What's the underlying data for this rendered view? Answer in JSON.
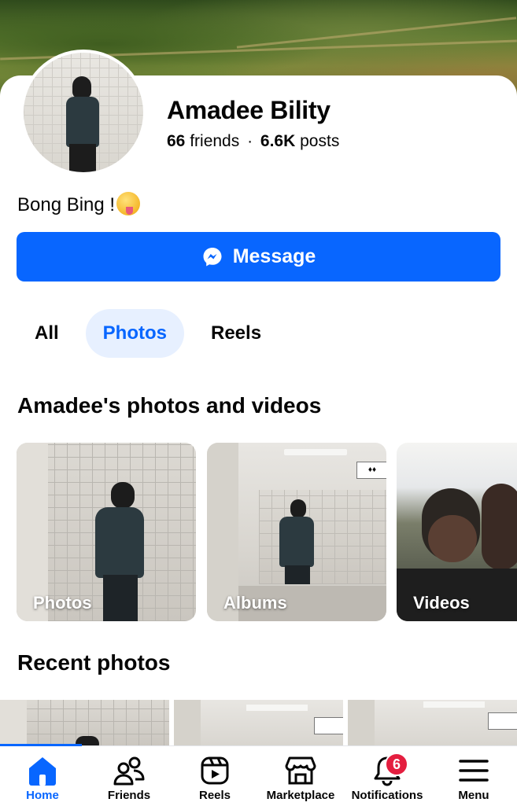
{
  "profile": {
    "name": "Amadee Bility",
    "friends_count": "66",
    "friends_label": "friends",
    "separator": "·",
    "posts_count": "6.6K",
    "posts_label": "posts",
    "bio": "Bong Bing !",
    "bio_emoji": "zany-face-emoji"
  },
  "actions": {
    "message_label": "Message",
    "message_icon": "messenger-icon",
    "accent": "#0866ff"
  },
  "tabs": [
    {
      "label": "All",
      "active": false
    },
    {
      "label": "Photos",
      "active": true
    },
    {
      "label": "Reels",
      "active": false
    }
  ],
  "media_section": {
    "title": "Amadee's photos and videos",
    "tiles": [
      {
        "label": "Photos"
      },
      {
        "label": "Albums"
      },
      {
        "label": "Videos"
      }
    ]
  },
  "recent_section": {
    "title": "Recent photos"
  },
  "bottom_nav": [
    {
      "label": "Home",
      "icon": "home-icon",
      "active": true
    },
    {
      "label": "Friends",
      "icon": "friends-icon",
      "active": false
    },
    {
      "label": "Reels",
      "icon": "reels-icon",
      "active": false
    },
    {
      "label": "Marketplace",
      "icon": "marketplace-icon",
      "active": false
    },
    {
      "label": "Notifications",
      "icon": "bell-icon",
      "active": false,
      "badge": "6"
    },
    {
      "label": "Menu",
      "icon": "menu-icon",
      "active": false
    }
  ]
}
